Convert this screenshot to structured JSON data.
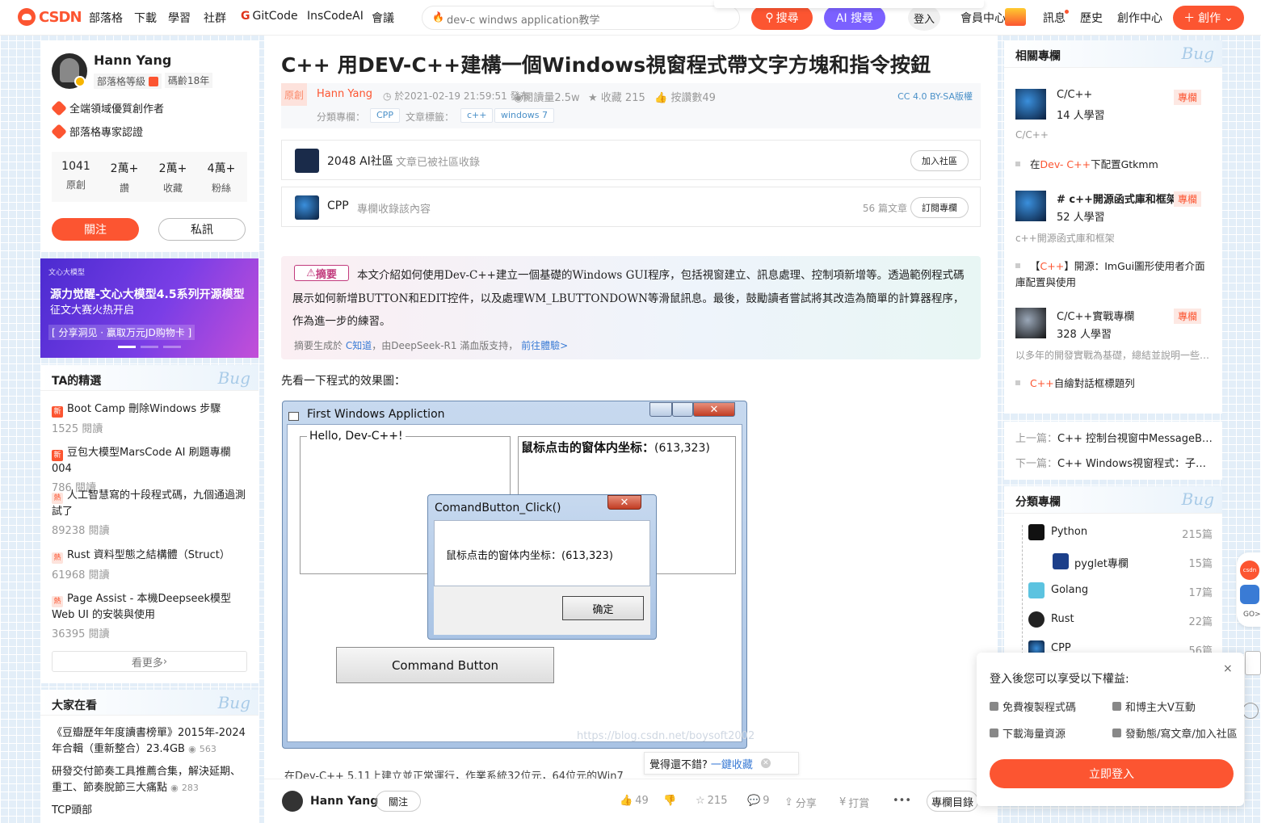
{
  "nav": {
    "logo": "CSDN",
    "links": [
      "部落格",
      "下載",
      "學習",
      "社群",
      "GitCode",
      "InsCodeAI",
      "會議"
    ],
    "search_query": "dev-c   windws application教学",
    "search_button": "搜尋",
    "ai_search_button": "AI 搜尋",
    "login": "登入",
    "member_center": "會員中心",
    "messages": "訊息",
    "history": "歷史",
    "creator_center": "創作中心",
    "create_button": "創作"
  },
  "profile": {
    "name": "Hann Yang",
    "level": "部落格等級",
    "age": "碼齡18年",
    "honors": [
      "全端領域優質創作者",
      "部落格專家認證"
    ],
    "stats": [
      {
        "value": "1041",
        "label": "原創"
      },
      {
        "value": "2萬+",
        "label": "讚"
      },
      {
        "value": "2萬+",
        "label": "收藏"
      },
      {
        "value": "4萬+",
        "label": "粉絲"
      }
    ],
    "follow_button": "關注",
    "message_button": "私訊"
  },
  "banner": {
    "brand": "文心大模型",
    "title": "源力觉醒-文心大模型4.5系列开源模型",
    "subtitle": "征文大赛火热开启",
    "cta": "[ 分享洞见 · 赢取万元JD购物卡 ]"
  },
  "picks": {
    "title": "TA的精選",
    "bug": "Bug",
    "items": [
      {
        "badge": "新",
        "title": "Boot Camp 刪除Windows 步驟",
        "reads": "1525 閱讀"
      },
      {
        "badge": "新",
        "title": "豆包大模型MarsCode AI 刷題專欄004",
        "reads": "786 閱讀"
      },
      {
        "badge": "熱",
        "title": "人工智慧寫的十段程式碼，九個通過測試了",
        "reads": "89238 閱讀"
      },
      {
        "badge": "熱",
        "title": "Rust 資料型態之結構體（Struct）",
        "reads": "61968 閱讀"
      },
      {
        "badge": "熱",
        "title": "Page Assist - 本機Deepseek模型Web UI 的安裝與使用",
        "reads": "36395 閱讀"
      }
    ],
    "more": "看更多"
  },
  "trending": {
    "title": "大家在看",
    "bug": "Bug",
    "items": [
      {
        "title": "《豆瓣歷年年度讀書榜單》2015年-2024年合輯（重新整合）23.4GB",
        "views": "563"
      },
      {
        "title": "研發交付節奏工具推薦合集，解決延期、重工、節奏脫節三大痛點",
        "views": "283"
      },
      {
        "title": "TCP頭部",
        "views": ""
      }
    ]
  },
  "article": {
    "title": "C++ 用DEV-C++建構一個Windows視窗程式帶文字方塊和指令按鈕",
    "original_badge": "原創",
    "author": "Hann Yang",
    "published": "於2021-02-19 21:59:51 發布",
    "reads": "閱讀量2.5w",
    "collects": "收藏 215",
    "likes": "按讚數49",
    "license": "CC 4.0 BY-SA版權",
    "category_label": "分類專欄：",
    "category": "CPP",
    "tags_label": "文章標籤：",
    "tags": [
      "c++",
      "windows 7"
    ],
    "community": {
      "name": "2048 AI社區",
      "desc": "文章已被社區收錄",
      "button": "加入社區"
    },
    "column": {
      "name": "CPP",
      "desc": "專欄收錄該內容",
      "count": "56 篇文章",
      "button": "訂閱專欄"
    },
    "summary": {
      "badge": "摘要",
      "text": "本文介紹如何使用Dev-C++建立一個基礎的Windows GUI程序，包括視窗建立、訊息處理、控制項新增等。透過範例程式碼展示如何新增BUTTON和EDIT控件，以及處理WM_LBUTTONDOWN等滑鼠訊息。最後，鼓勵讀者嘗試將其改造為簡單的計算器程序，作為進一步的練習。",
      "foot_prefix": "摘要生成於",
      "foot_link": "C知道",
      "foot_mid": "，由DeepSeek-R1 滿血版支持，",
      "foot_link2": "前往體驗>"
    },
    "intro": "先看一下程式的效果圖：",
    "window": {
      "title": "First Windows Appliction",
      "group1": "Hello, Dev-C++!",
      "group2_prefix": "鼠标点击的窗体内坐标：",
      "group2_value": "(613,323)",
      "command_button": "Command Button",
      "watermark": "https://blog.csdn.net/boysoft2002"
    },
    "msgbox": {
      "title": "ComandButton_Click()",
      "text": "鼠标点击的窗体内坐标：(613,323)",
      "ok": "确定"
    },
    "para2": "在Dev-C++ 5.11上建立並正常運行，作業系統32位元，64位元的Win7",
    "tooltip": {
      "text": "覺得還不錯?",
      "link": "一鍵收藏"
    },
    "bottom": {
      "author": "Hann Yang",
      "follow": "關注",
      "likes": "49",
      "collects": "215",
      "comments": "9",
      "share": "分享",
      "tip": "打賞",
      "more": "•••",
      "directory": "專欄目錄"
    }
  },
  "related": {
    "title": "相關專欄",
    "bug": "Bug",
    "items": [
      {
        "name": "C/C++",
        "learners": "14 人學習",
        "tag": "專欄",
        "desc": "C/C++",
        "article_prefix": "在",
        "article_hl": "Dev- C++",
        "article_suffix": "下配置Gtkmm"
      },
      {
        "name": "# c++開源函式庫和框架",
        "learners": "52 人學習",
        "tag": "專欄",
        "desc": "c++開源函式庫和框架",
        "article_prefix": "【",
        "article_hl": "C++",
        "article_suffix": "】開源：ImGui圖形使用者介面庫配置與使用"
      },
      {
        "name": "C/C++實戰專欄",
        "learners": "328 人學習",
        "tag": "專欄",
        "desc": "以多年的開發實戰為基礎，總結並說明一些C/C++基礎知識",
        "article_prefix": "",
        "article_hl": "C++",
        "article_suffix": "自繪對話框標題列"
      }
    ]
  },
  "prevnext": {
    "prev_label": "上一篇：",
    "prev": "C++ 控制台視窗中MessageBox函數的用法",
    "next_label": "下一篇：",
    "next": "C++ Windows視窗程式：子視窗的建立"
  },
  "categories": {
    "title": "分類專欄",
    "bug": "Bug",
    "items": [
      {
        "name": "Python",
        "count": "215篇"
      },
      {
        "name": "pyglet專欄",
        "count": "15篇"
      },
      {
        "name": "Golang",
        "count": "17篇"
      },
      {
        "name": "Rust",
        "count": "22篇"
      },
      {
        "name": "CPP",
        "count": "56篇"
      }
    ]
  },
  "sidetools": {
    "csdn": "csdn",
    "go": "GO>"
  },
  "login_panel": {
    "title": "登入後您可以享受以下權益:",
    "benefits": [
      "免費複製程式碼",
      "和博主大V互動",
      "下載海量資源",
      "發動態/寫文章/加入社區"
    ],
    "button": "立即登入",
    "close": "×"
  },
  "colors": {
    "brand": "#fc5531",
    "ai": "#7b61ff",
    "link": "#3a7bd5"
  }
}
